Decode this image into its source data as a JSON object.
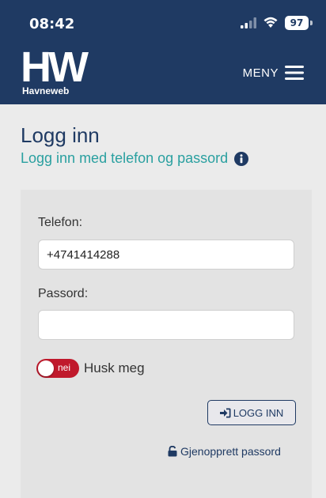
{
  "status_bar": {
    "time": "08:42",
    "battery": "97",
    "icons": [
      "signal-icon",
      "wifi-icon",
      "battery-icon"
    ]
  },
  "header": {
    "logo_mark": "HW",
    "logo_sub": "Havneweb",
    "menu_label": "MENY",
    "menu_icon": "hamburger-icon",
    "background": "#1f3a63"
  },
  "page": {
    "title": "Logg inn",
    "subtitle": "Logg inn med telefon og passord",
    "subtitle_icon": "info-icon"
  },
  "form": {
    "phone_label": "Telefon:",
    "phone_value": "+4741414288",
    "password_label": "Passord:",
    "password_value": "",
    "remember": {
      "toggle_text": "nei",
      "label": "Husk meg",
      "state": "off"
    },
    "login_button": "LOGG INN",
    "login_icon": "sign-in-icon",
    "recover_link": "Gjenopprett passord",
    "recover_icon": "unlock-icon"
  },
  "colors": {
    "brand": "#1f3a63",
    "accent": "#2aa0a0",
    "toggle_off": "#c0192c"
  }
}
